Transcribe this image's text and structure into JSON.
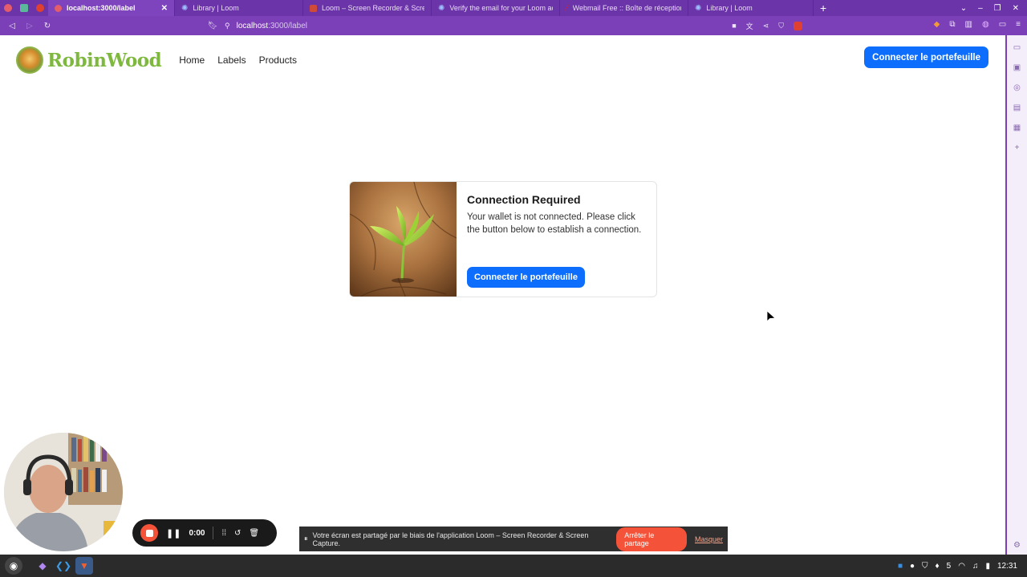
{
  "browser": {
    "tabs": [
      {
        "title": "localhost:3000/label",
        "active": true,
        "favicon_color": "#e35d6a"
      },
      {
        "title": "Library | Loom",
        "active": false,
        "favicon_color": "#625df5"
      },
      {
        "title": "Loom – Screen Recorder & Screen",
        "active": false,
        "favicon_color": "#d04a3a"
      },
      {
        "title": "Verify the email for your Loom acc",
        "active": false,
        "favicon_color": "#625df5"
      },
      {
        "title": "Webmail Free :: Boîte de réception",
        "active": false,
        "favicon_color": "#d0202a"
      },
      {
        "title": "Library | Loom",
        "active": false,
        "favicon_color": "#625df5"
      }
    ],
    "url_host": "localhost",
    "url_path": ":3000/label",
    "accent_color": "#7b3fb8"
  },
  "site": {
    "brand": "RobinWood",
    "nav": [
      "Home",
      "Labels",
      "Products"
    ],
    "connect_button": "Connecter le portefeuille"
  },
  "card": {
    "title": "Connection Required",
    "text": "Your wallet is not connected. Please click the button below to establish a connection.",
    "button": "Connecter le portefeuille"
  },
  "recorder": {
    "timer": "0:00"
  },
  "share_notice": {
    "text": "Votre écran est partagé par le biais de l'application Loom – Screen Recorder & Screen Capture.",
    "stop_label": "Arrêter le partage",
    "hide_label": "Masquer"
  },
  "taskbar": {
    "clock": "12:31",
    "volume_level": "5"
  },
  "colors": {
    "primary_button": "#0d6efd",
    "brand_green": "#7fb83f",
    "loom_orange": "#f4533a"
  }
}
